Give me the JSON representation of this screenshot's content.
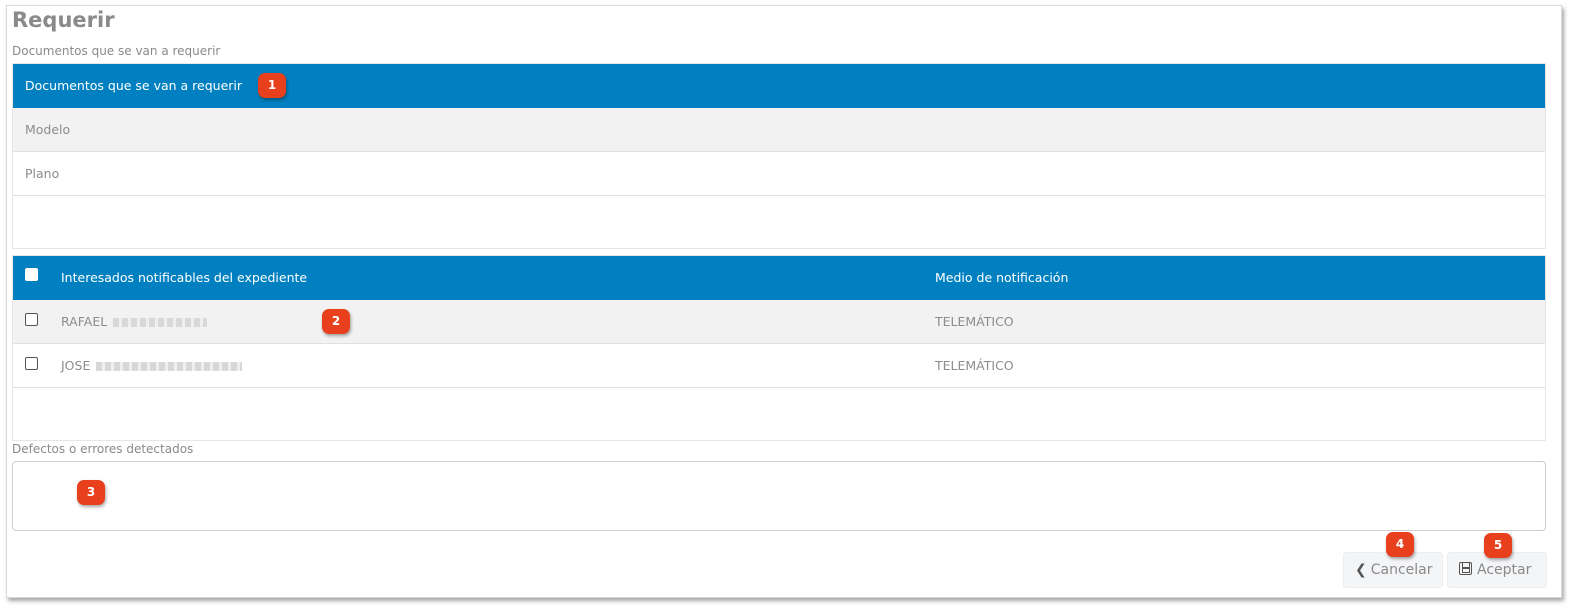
{
  "page": {
    "title": "Requerir",
    "subtitle": "Documentos que se van a requerir"
  },
  "documents_table": {
    "header": "Documentos que se van a requerir",
    "rows": [
      "Modelo",
      "Plano"
    ]
  },
  "interested_table": {
    "header_name": "Interesados notificables del expediente",
    "header_medium": "Medio de notificación",
    "rows": [
      {
        "name": "RAFAEL",
        "medium": "TELEMÁTICO",
        "checked": false
      },
      {
        "name": "JOSE",
        "medium": "TELEMÁTICO",
        "checked": false
      }
    ]
  },
  "defects": {
    "label": "Defectos o errores detectados",
    "value": ""
  },
  "buttons": {
    "cancel_label": "Cancelar",
    "accept_label": "Aceptar",
    "cancel_icon": "chevron-left-icon",
    "accept_icon": "save-icon"
  },
  "badges": [
    "1",
    "2",
    "3",
    "4",
    "5"
  ],
  "colors": {
    "header_blue": "#0080c0",
    "badge_red": "#e8401c"
  }
}
